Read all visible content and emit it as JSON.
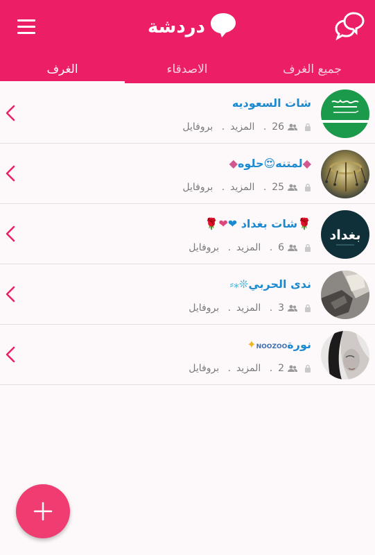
{
  "app": {
    "title": "دردشة"
  },
  "tabs": [
    {
      "label": "الغرف",
      "active": true
    },
    {
      "label": "الاصدقاء",
      "active": false
    },
    {
      "label": "جميع الغرف",
      "active": false
    }
  ],
  "rooms": [
    {
      "name": "شات السعوديه",
      "members": "26",
      "more": "المزيد",
      "profile": "بروفايل",
      "avatar": "saudi-flag"
    },
    {
      "name": "لمتنه😍حلوه",
      "members": "25",
      "more": "المزيد",
      "profile": "بروفايل",
      "avatar": "carousel-photo"
    },
    {
      "name": "شات بغداد ❤",
      "members": "6",
      "more": "المزيد",
      "profile": "بروفايل",
      "avatar": "baghdad-logo",
      "avatar_text": "بغداد"
    },
    {
      "name": "ندى الحربي",
      "members": "3",
      "more": "المزيد",
      "profile": "بروفايل",
      "avatar": "photo-hands"
    },
    {
      "name": "نورة",
      "members": "2",
      "more": "المزيد",
      "profile": "بروفايل",
      "avatar": "photo-girl"
    }
  ],
  "colors": {
    "primary": "#ec1f66",
    "link": "#1d8ad0",
    "fab": "#ef3d72"
  }
}
